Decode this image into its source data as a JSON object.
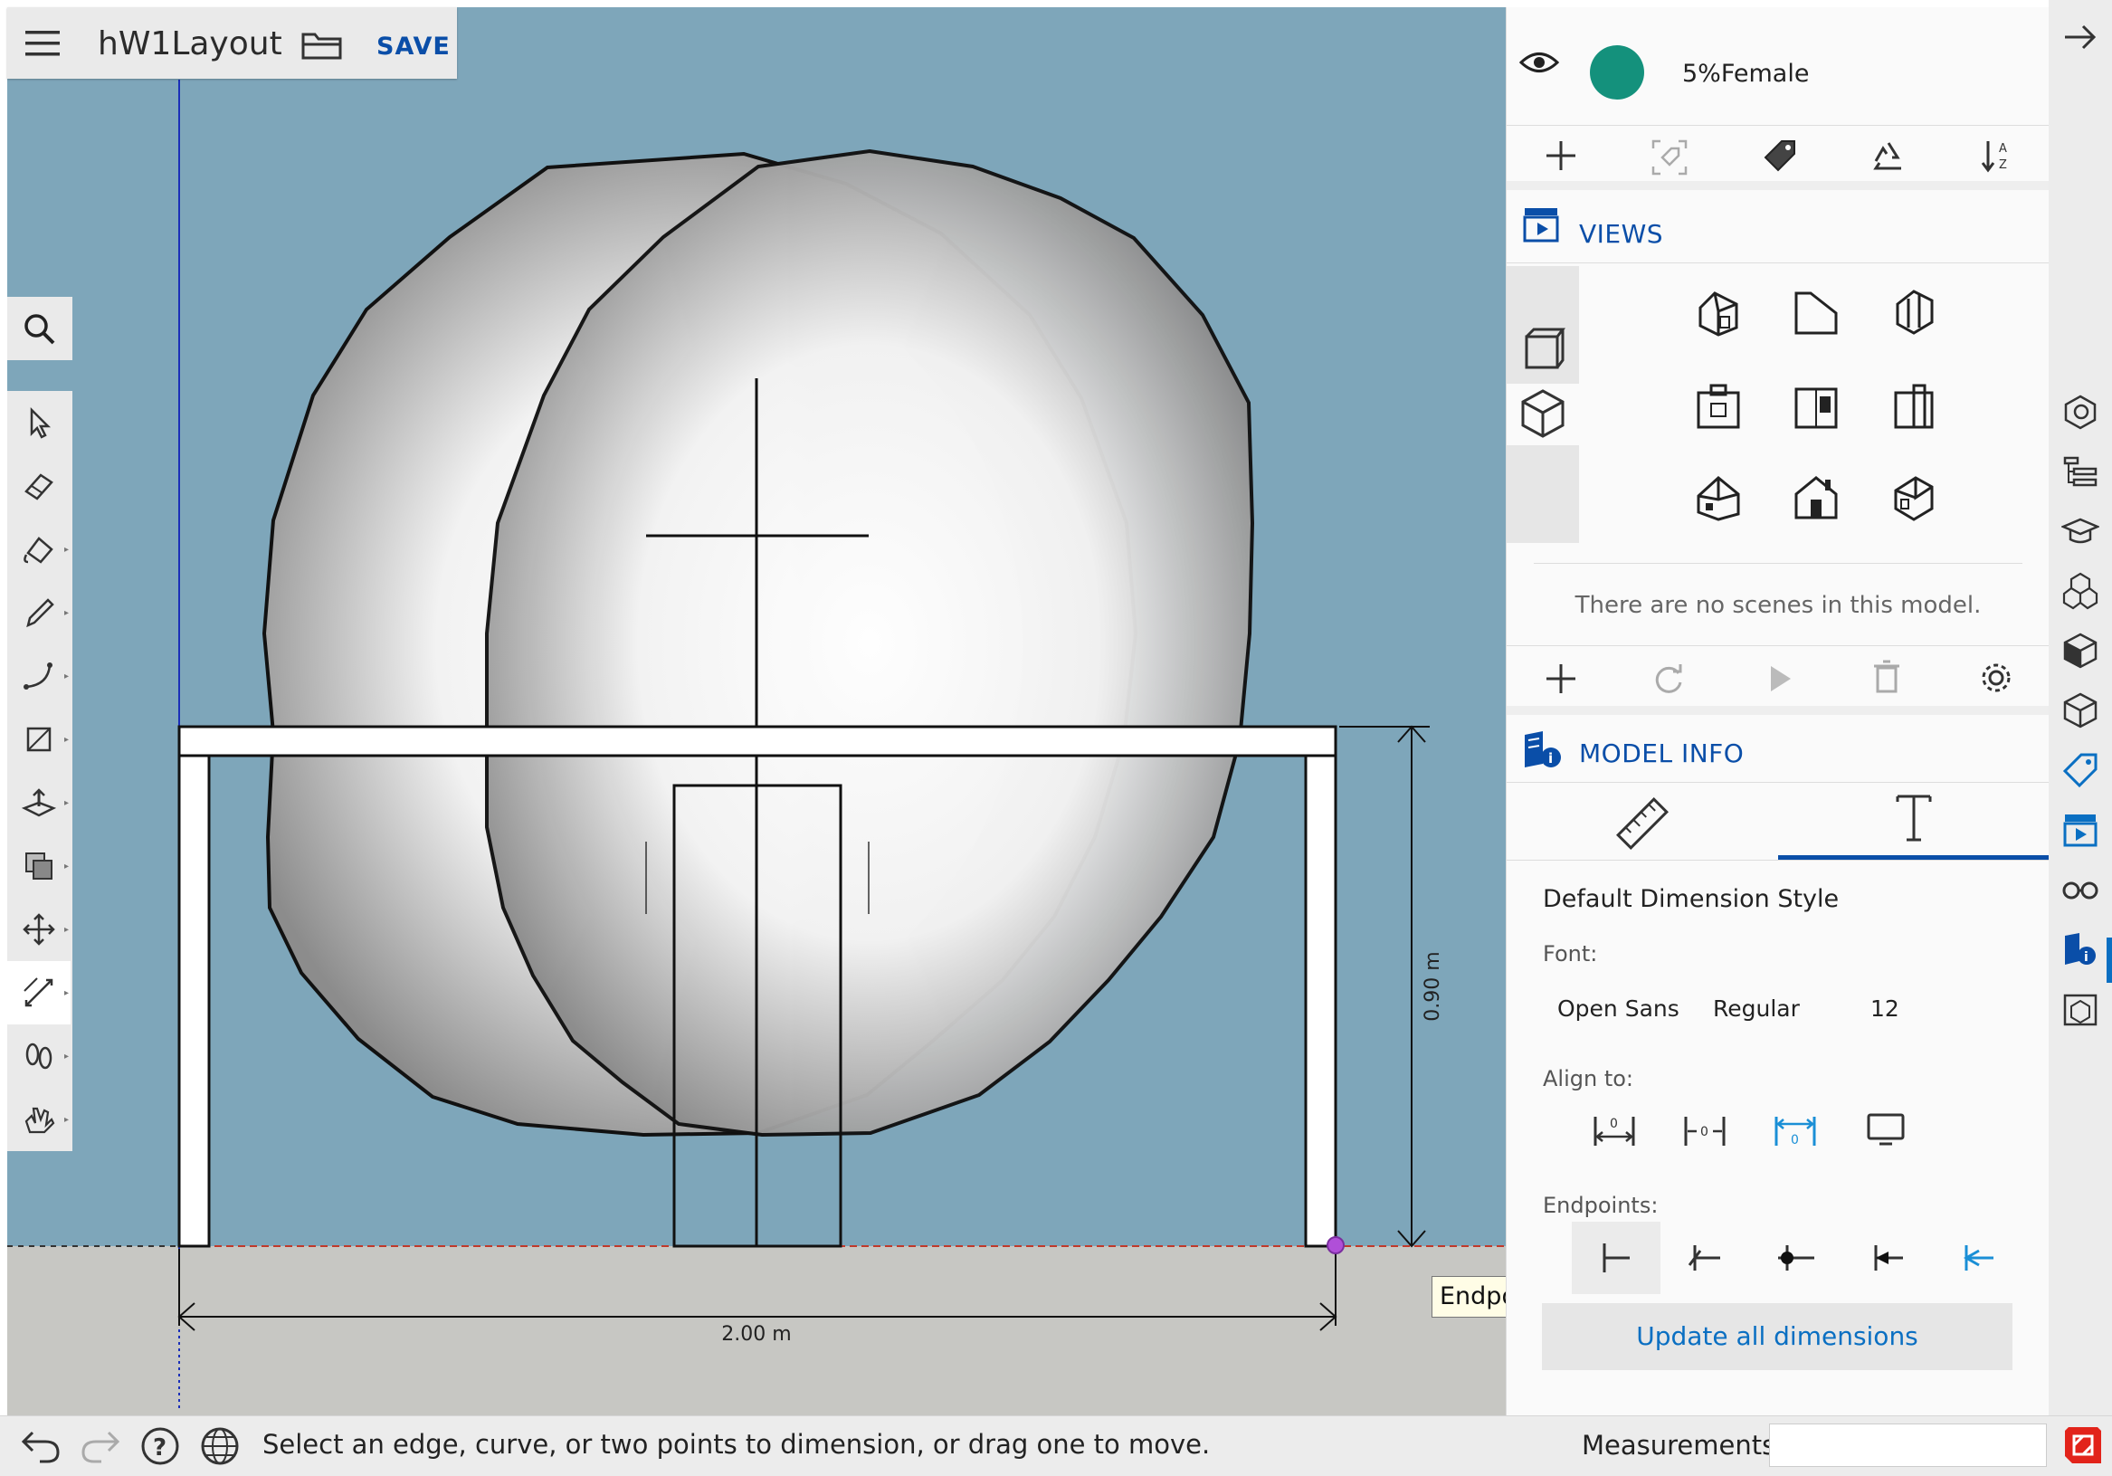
{
  "app": {
    "title": "hW1Layout",
    "save_label": "SAVE",
    "menu_icon": "hamburger-menu-icon",
    "open_icon": "folder-icon"
  },
  "colors": {
    "sky": "#7ea6ba",
    "ground": "#c7c7c3",
    "accent": "#0a4ea8",
    "link": "#0a6fc2",
    "tag_dot": "#14917c",
    "endpoint_marker": "#b04fd8"
  },
  "toolbar": {
    "tools": [
      {
        "name": "select-tool",
        "icon": "arrow-cursor-icon"
      },
      {
        "name": "eraser-tool",
        "icon": "eraser-icon"
      },
      {
        "name": "paint-tool",
        "icon": "paint-bucket-icon"
      },
      {
        "name": "line-tool",
        "icon": "pencil-icon"
      },
      {
        "name": "arc-tool",
        "icon": "arc-icon"
      },
      {
        "name": "rectangle-tool",
        "icon": "rectangle-icon"
      },
      {
        "name": "push-pull-tool",
        "icon": "push-pull-icon"
      },
      {
        "name": "offset-tool",
        "icon": "offset-icon"
      },
      {
        "name": "move-tool",
        "icon": "move-arrows-icon"
      },
      {
        "name": "dimension-tool",
        "icon": "dimension-icon"
      },
      {
        "name": "walk-tool",
        "icon": "footprints-icon"
      },
      {
        "name": "orbit-tool",
        "icon": "hand-icon"
      }
    ]
  },
  "canvas": {
    "width_dimension": "2.00 m",
    "height_dimension": "0.90 m",
    "tooltip": "Endpoint in Group"
  },
  "tags": {
    "tag_name": "5%Female",
    "actions": [
      "add-icon",
      "tag-select-icon",
      "tag-icon",
      "recycle-icon",
      "sort-az-icon"
    ]
  },
  "views": {
    "title": "VIEWS",
    "empty_message": "There are no scenes in this model.",
    "scene_actions": [
      "add-icon",
      "refresh-icon",
      "play-icon",
      "trash-icon",
      "gear-icon"
    ]
  },
  "model_info": {
    "title": "MODEL INFO",
    "heading": "Default Dimension Style",
    "font_label": "Font:",
    "font_family": "Open Sans",
    "font_weight": "Regular",
    "font_size": "12",
    "align_label": "Align to:",
    "endpoints_label": "Endpoints:",
    "update_button": "Update all dimensions"
  },
  "status": {
    "message": "Select an edge, curve, or two points to dimension, or drag one to move.",
    "measurements_label": "Measurements",
    "measurements_value": ""
  }
}
